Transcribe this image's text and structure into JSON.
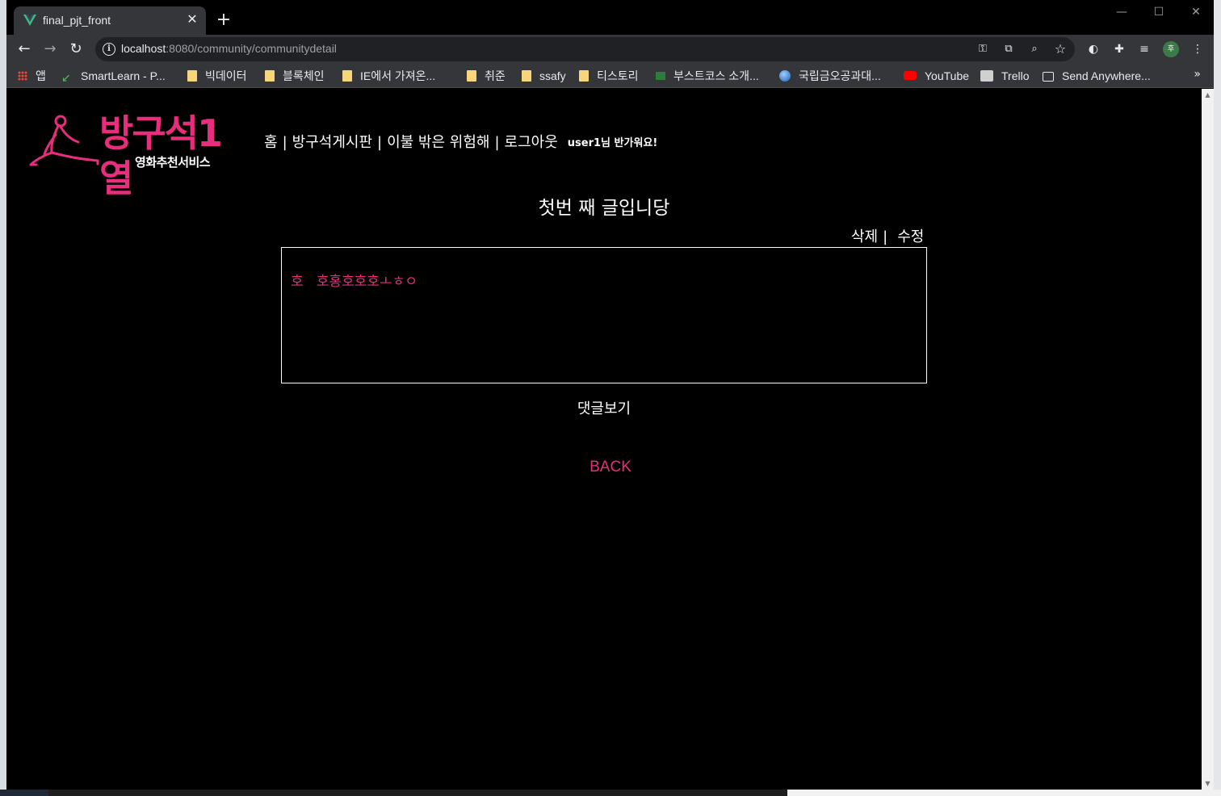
{
  "browser": {
    "tab_title": "final_pjt_front",
    "new_tab_label": "+",
    "url_host": "localhost",
    "url_rest": ":8080/community/communitydetail",
    "bookmarks": [
      {
        "label": "앱",
        "icon": "apps-grid-icon"
      },
      {
        "label": "SmartLearn - P...",
        "icon": "smartlearn-icon"
      },
      {
        "label": "빅데이터",
        "icon": "folder-icon"
      },
      {
        "label": "블록체인",
        "icon": "folder-icon"
      },
      {
        "label": "IE에서 가져온...",
        "icon": "folder-icon"
      },
      {
        "label": "취준",
        "icon": "folder-icon"
      },
      {
        "label": "ssafy",
        "icon": "folder-icon"
      },
      {
        "label": "티스토리",
        "icon": "folder-icon"
      },
      {
        "label": "부스트코스 소개...",
        "icon": "boostcourse-icon"
      },
      {
        "label": "국립금오공과대...",
        "icon": "globe-icon"
      },
      {
        "label": "YouTube",
        "icon": "youtube-icon"
      },
      {
        "label": "Trello",
        "icon": "trello-icon"
      },
      {
        "label": "Send Anywhere...",
        "icon": "send-anywhere-icon"
      }
    ],
    "bookmarks_more": "»",
    "profile_initial": "후"
  },
  "site": {
    "logo_title": "방구석1열",
    "logo_subtitle": "영화추천서비스",
    "accent_color": "#e72d7b",
    "nav": {
      "home": "홈",
      "board": "방구석게시판",
      "recommend": "이불 밖은 위험해",
      "logout": "로그아웃",
      "separator": "|",
      "greeting": "user1님 반가워요!"
    }
  },
  "post": {
    "title": "첫번 째 글입니당",
    "delete_label": "삭제",
    "action_separator": "|",
    "edit_label": "수정",
    "content": "호   호홍호호호ㅗㅎㅇ",
    "comments_label": "댓글보기",
    "back_label": "BACK"
  }
}
